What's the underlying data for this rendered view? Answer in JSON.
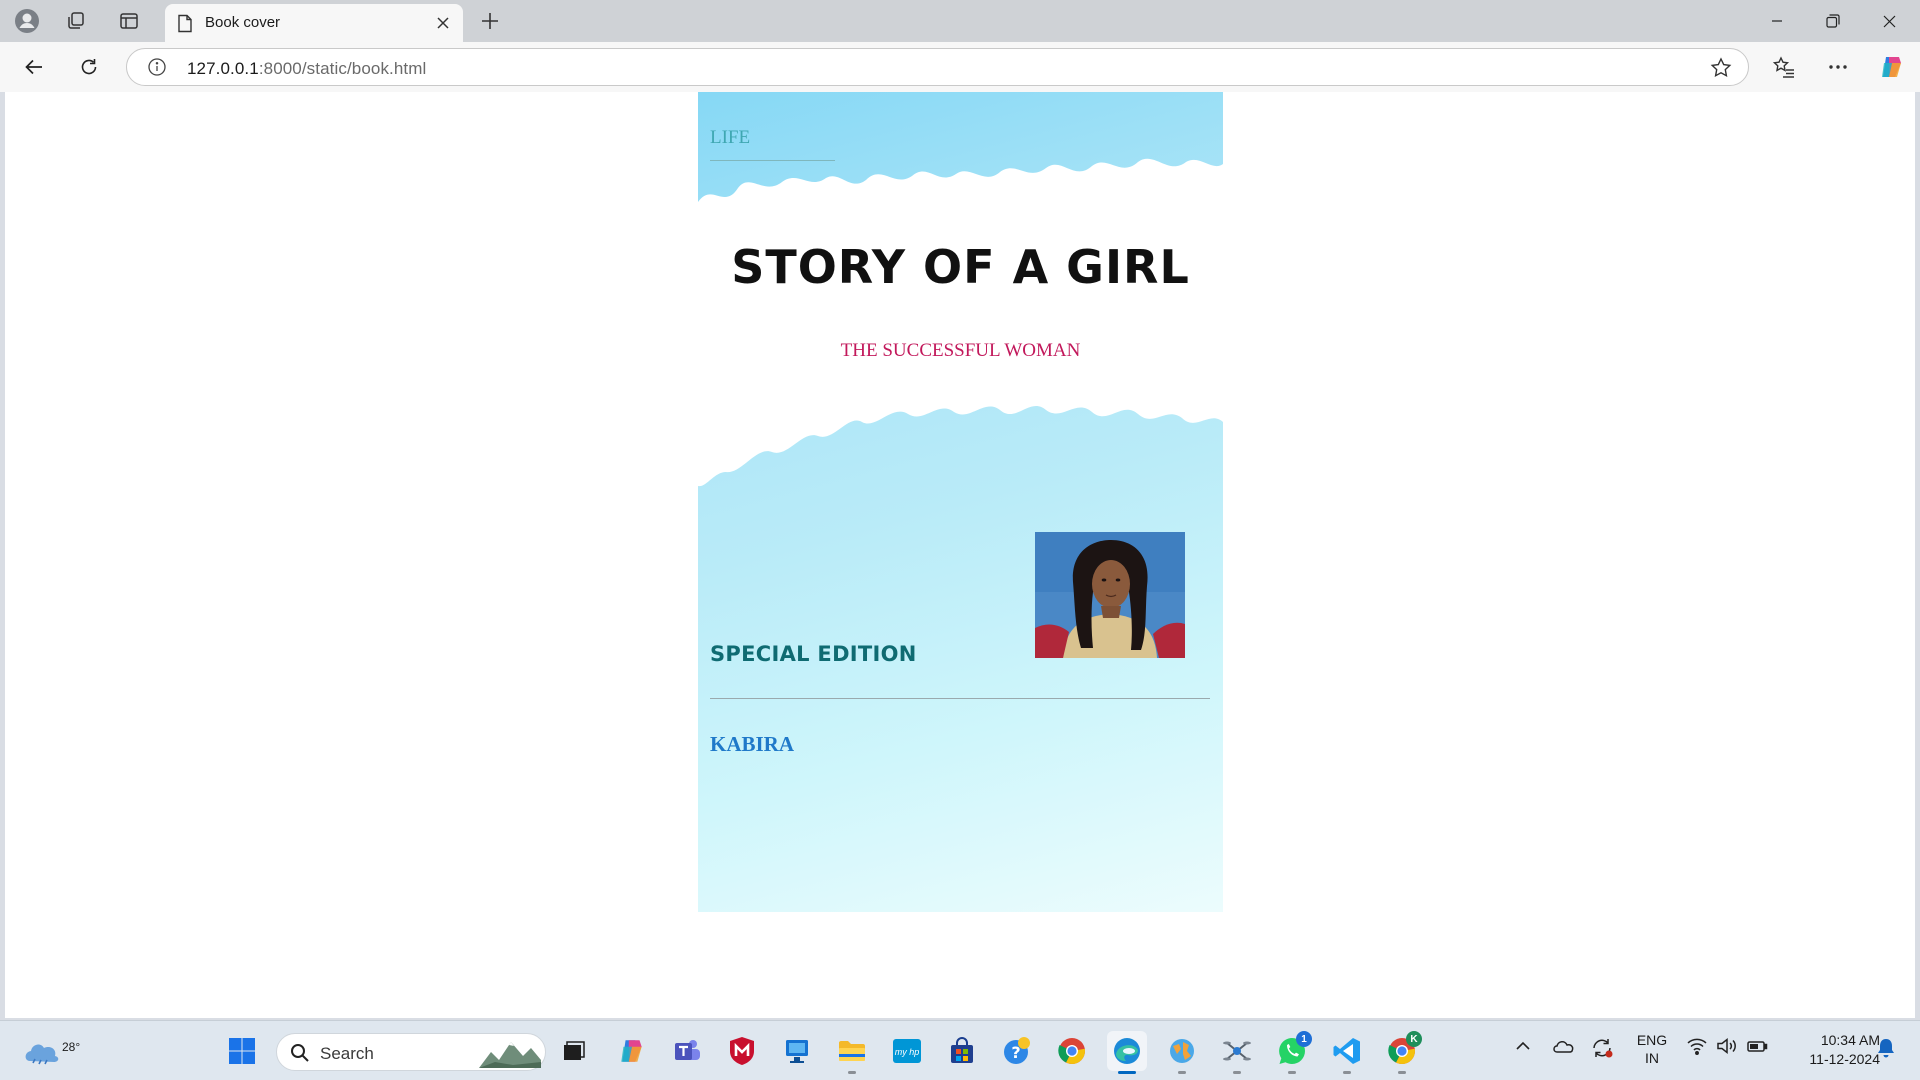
{
  "browser": {
    "tab_title": "Book cover",
    "url_host": "127.0.0.1",
    "url_path": ":8000/static/book.html"
  },
  "cover": {
    "kicker": "LIFE",
    "title": "STORY OF A GIRL",
    "subtitle": "THE SUCCESSFUL WOMAN",
    "edition": "SPECIAL EDITION",
    "author": "KABIRA",
    "colors": {
      "title": "#111111",
      "subtitle": "#c2185b",
      "edition": "#0f6b72",
      "author": "#1f79c9",
      "kicker": "#3fa7b2"
    }
  },
  "taskbar": {
    "weather_temp": "28°",
    "search_label": "Search",
    "whatsapp_badge": "1",
    "chrome_profile_badge": "K",
    "lang_line1": "ENG",
    "lang_line2": "IN",
    "time": "10:34 AM",
    "date": "11-12-2024"
  }
}
